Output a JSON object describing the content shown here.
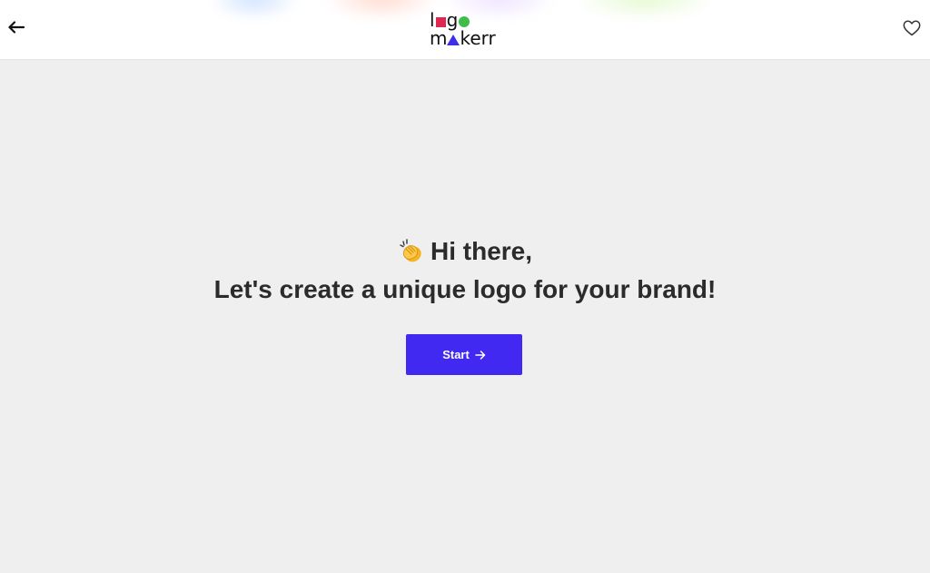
{
  "header": {
    "back_icon": "arrow-left-icon",
    "favorite_icon": "heart-outline-icon",
    "logo": {
      "line1": {
        "before": "l",
        "after": "g"
      },
      "line2": {
        "before": "m",
        "after": "kerr"
      },
      "colors": {
        "square": "#e0284f",
        "circle": "#3fbd4b",
        "triangle": "#3e2ee8"
      }
    }
  },
  "main": {
    "greeting": "Hi there,",
    "greeting_icon": "clapping-hands-icon",
    "headline": "Let's create a unique logo for your brand!",
    "start_button": {
      "label": "Start",
      "icon": "arrow-right-icon",
      "color": "#4129f2"
    }
  },
  "colors": {
    "background": "#efefef",
    "header_background": "#ffffff",
    "text": "#2b2b2b"
  }
}
